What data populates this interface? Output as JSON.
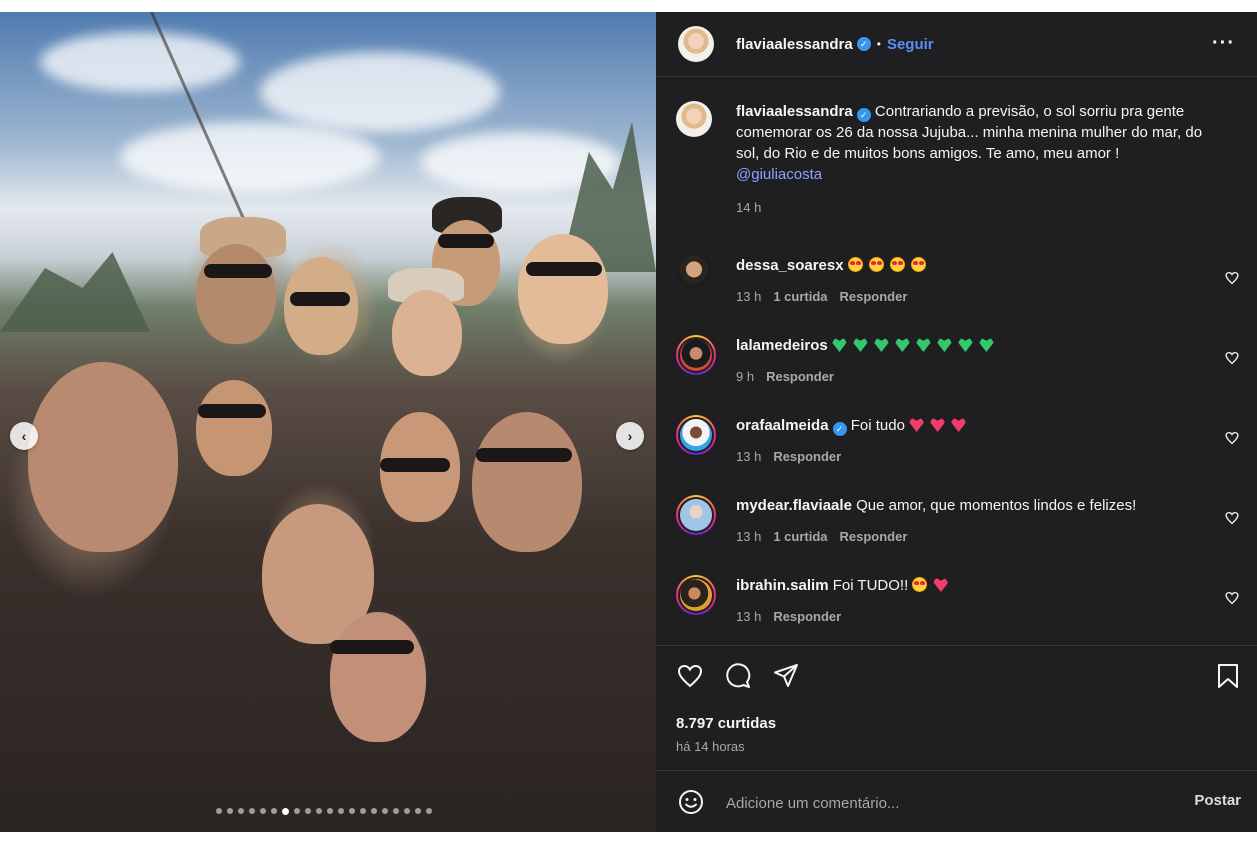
{
  "post": {
    "username": "flaviaalessandra",
    "follow_label": "Seguir",
    "separator": "•",
    "more_label": "···",
    "caption": {
      "username": "flaviaalessandra",
      "text": "Contrariando a previsão, o sol sorriu pra gente comemorar os 26 da nossa Jujuba... minha menina mulher do mar, do sol, do Rio e de muitos bons amigos. Te amo, meu amor !",
      "mention": "@giuliacosta",
      "time": "14 h"
    },
    "comments": [
      {
        "username": "dessa_soaresx",
        "text": "",
        "emoji": [
          "love",
          "love",
          "love",
          "love"
        ],
        "time": "13 h",
        "likes": "1 curtida",
        "reply": "Responder",
        "verified": false
      },
      {
        "username": "lalamedeiros",
        "text": "",
        "emoji": [
          "green",
          "green",
          "green",
          "green",
          "green",
          "green",
          "green",
          "green"
        ],
        "time": "9 h",
        "likes": "",
        "reply": "Responder",
        "verified": false
      },
      {
        "username": "orafaalmeida",
        "text": "Foi tudo",
        "emoji": [
          "pink",
          "pink",
          "pink"
        ],
        "time": "13 h",
        "likes": "",
        "reply": "Responder",
        "verified": true
      },
      {
        "username": "mydear.flaviaale",
        "text": "Que amor, que momentos lindos e felizes!",
        "emoji": [],
        "time": "13 h",
        "likes": "1 curtida",
        "reply": "Responder",
        "verified": false
      },
      {
        "username": "ibrahin.salim",
        "text": "Foi TUDO!!",
        "emoji": [
          "love",
          "pink"
        ],
        "time": "13 h",
        "likes": "",
        "reply": "Responder",
        "verified": false
      }
    ],
    "likes_count": "8.797 curtidas",
    "posted_ago": "há 14 horas",
    "comment_placeholder": "Adicione um comentário...",
    "post_button": "Postar"
  },
  "carousel": {
    "total_slides": 20,
    "active_index": 6,
    "prev_label": "‹",
    "next_label": "›"
  },
  "colors": {
    "panel_bg": "#1f1f22",
    "link_blue": "#5b8cff",
    "verified_blue": "#3797f0",
    "muted_text": "#a8a8a8"
  }
}
